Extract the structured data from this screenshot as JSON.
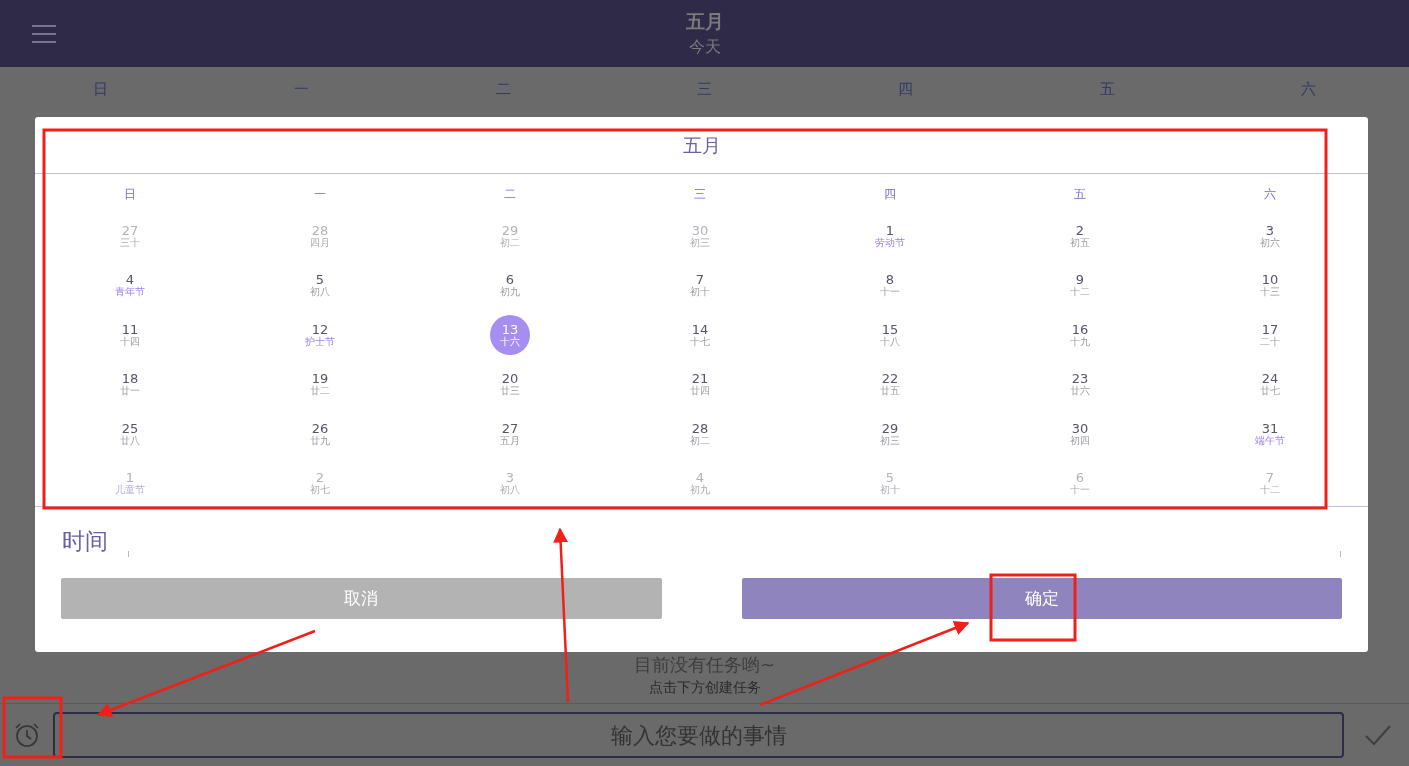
{
  "header": {
    "title": "五月",
    "subtitle": "今天"
  },
  "weekdays": [
    "日",
    "一",
    "二",
    "三",
    "四",
    "五",
    "六"
  ],
  "dialog": {
    "title": "五月",
    "weekdays": [
      "日",
      "一",
      "二",
      "三",
      "四",
      "五",
      "六"
    ],
    "weeks": [
      [
        {
          "day": "27",
          "lunar": "三十",
          "in_month": false,
          "festival": false,
          "selected": false
        },
        {
          "day": "28",
          "lunar": "四月",
          "in_month": false,
          "festival": false,
          "selected": false
        },
        {
          "day": "29",
          "lunar": "初二",
          "in_month": false,
          "festival": false,
          "selected": false
        },
        {
          "day": "30",
          "lunar": "初三",
          "in_month": false,
          "festival": false,
          "selected": false
        },
        {
          "day": "1",
          "lunar": "劳动节",
          "in_month": true,
          "festival": true,
          "selected": false
        },
        {
          "day": "2",
          "lunar": "初五",
          "in_month": true,
          "festival": false,
          "selected": false
        },
        {
          "day": "3",
          "lunar": "初六",
          "in_month": true,
          "festival": false,
          "selected": false
        }
      ],
      [
        {
          "day": "4",
          "lunar": "青年节",
          "in_month": true,
          "festival": true,
          "selected": false
        },
        {
          "day": "5",
          "lunar": "初八",
          "in_month": true,
          "festival": false,
          "selected": false
        },
        {
          "day": "6",
          "lunar": "初九",
          "in_month": true,
          "festival": false,
          "selected": false
        },
        {
          "day": "7",
          "lunar": "初十",
          "in_month": true,
          "festival": false,
          "selected": false
        },
        {
          "day": "8",
          "lunar": "十一",
          "in_month": true,
          "festival": false,
          "selected": false
        },
        {
          "day": "9",
          "lunar": "十二",
          "in_month": true,
          "festival": false,
          "selected": false
        },
        {
          "day": "10",
          "lunar": "十三",
          "in_month": true,
          "festival": false,
          "selected": false
        }
      ],
      [
        {
          "day": "11",
          "lunar": "十四",
          "in_month": true,
          "festival": false,
          "selected": false
        },
        {
          "day": "12",
          "lunar": "护士节",
          "in_month": true,
          "festival": true,
          "selected": false
        },
        {
          "day": "13",
          "lunar": "十六",
          "in_month": true,
          "festival": false,
          "selected": true
        },
        {
          "day": "14",
          "lunar": "十七",
          "in_month": true,
          "festival": false,
          "selected": false
        },
        {
          "day": "15",
          "lunar": "十八",
          "in_month": true,
          "festival": false,
          "selected": false
        },
        {
          "day": "16",
          "lunar": "十九",
          "in_month": true,
          "festival": false,
          "selected": false
        },
        {
          "day": "17",
          "lunar": "二十",
          "in_month": true,
          "festival": false,
          "selected": false
        }
      ],
      [
        {
          "day": "18",
          "lunar": "廿一",
          "in_month": true,
          "festival": false,
          "selected": false
        },
        {
          "day": "19",
          "lunar": "廿二",
          "in_month": true,
          "festival": false,
          "selected": false
        },
        {
          "day": "20",
          "lunar": "廿三",
          "in_month": true,
          "festival": false,
          "selected": false
        },
        {
          "day": "21",
          "lunar": "廿四",
          "in_month": true,
          "festival": false,
          "selected": false
        },
        {
          "day": "22",
          "lunar": "廿五",
          "in_month": true,
          "festival": false,
          "selected": false
        },
        {
          "day": "23",
          "lunar": "廿六",
          "in_month": true,
          "festival": false,
          "selected": false
        },
        {
          "day": "24",
          "lunar": "廿七",
          "in_month": true,
          "festival": false,
          "selected": false
        }
      ],
      [
        {
          "day": "25",
          "lunar": "廿八",
          "in_month": true,
          "festival": false,
          "selected": false
        },
        {
          "day": "26",
          "lunar": "廿九",
          "in_month": true,
          "festival": false,
          "selected": false
        },
        {
          "day": "27",
          "lunar": "五月",
          "in_month": true,
          "festival": false,
          "selected": false
        },
        {
          "day": "28",
          "lunar": "初二",
          "in_month": true,
          "festival": false,
          "selected": false
        },
        {
          "day": "29",
          "lunar": "初三",
          "in_month": true,
          "festival": false,
          "selected": false
        },
        {
          "day": "30",
          "lunar": "初四",
          "in_month": true,
          "festival": false,
          "selected": false
        },
        {
          "day": "31",
          "lunar": "端午节",
          "in_month": true,
          "festival": true,
          "selected": false
        }
      ],
      [
        {
          "day": "1",
          "lunar": "儿童节",
          "in_month": false,
          "festival": true,
          "selected": false
        },
        {
          "day": "2",
          "lunar": "初七",
          "in_month": false,
          "festival": false,
          "selected": false
        },
        {
          "day": "3",
          "lunar": "初八",
          "in_month": false,
          "festival": false,
          "selected": false
        },
        {
          "day": "4",
          "lunar": "初九",
          "in_month": false,
          "festival": false,
          "selected": false
        },
        {
          "day": "5",
          "lunar": "初十",
          "in_month": false,
          "festival": false,
          "selected": false
        },
        {
          "day": "6",
          "lunar": "十一",
          "in_month": false,
          "festival": false,
          "selected": false
        },
        {
          "day": "7",
          "lunar": "十二",
          "in_month": false,
          "festival": false,
          "selected": false
        }
      ]
    ],
    "time_label": "时间",
    "cancel": "取消",
    "confirm": "确定"
  },
  "empty_state": {
    "message": "目前没有任务哟~",
    "hint": "点击下方创建任务"
  },
  "task_input": {
    "placeholder": "输入您要做的事情"
  }
}
